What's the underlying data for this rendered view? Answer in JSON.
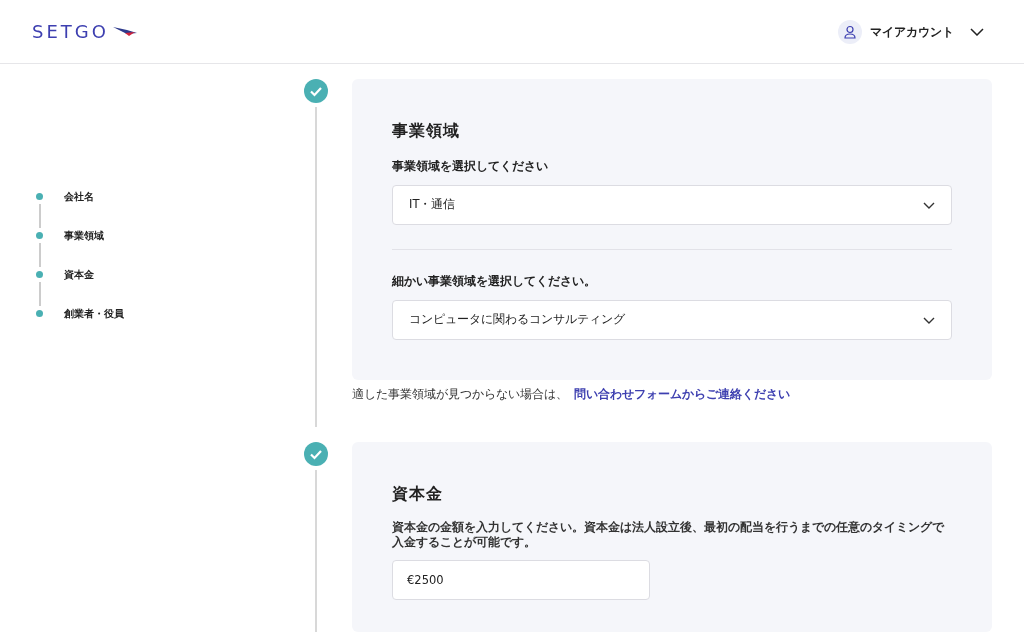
{
  "header": {
    "logo": "SETGO",
    "account": "マイアカウント"
  },
  "steps": [
    {
      "label": "会社名"
    },
    {
      "label": "事業領域"
    },
    {
      "label": "資本金"
    },
    {
      "label": "創業者・役員"
    }
  ],
  "sections": [
    {
      "completed": true,
      "title": "事業領域",
      "fields": [
        {
          "kind": "select",
          "label": "事業領域を選択してください",
          "value": "IT・通信"
        },
        {
          "kind": "select",
          "label": "細かい事業領域を選択してください。",
          "value": "コンピュータに関わるコンサルティング"
        }
      ],
      "help": {
        "text": "適した事業領域が見つからない場合は、",
        "link": "問い合わせフォームからご連絡ください"
      }
    },
    {
      "completed": true,
      "title": "資本金",
      "fields": [
        {
          "kind": "input",
          "label": "資本金の金額を入力してください。資本金は法人設立後、最初の配当を行うまでの任意のタイミングで入金することが可能です。",
          "value": "€2500"
        }
      ]
    }
  ]
}
